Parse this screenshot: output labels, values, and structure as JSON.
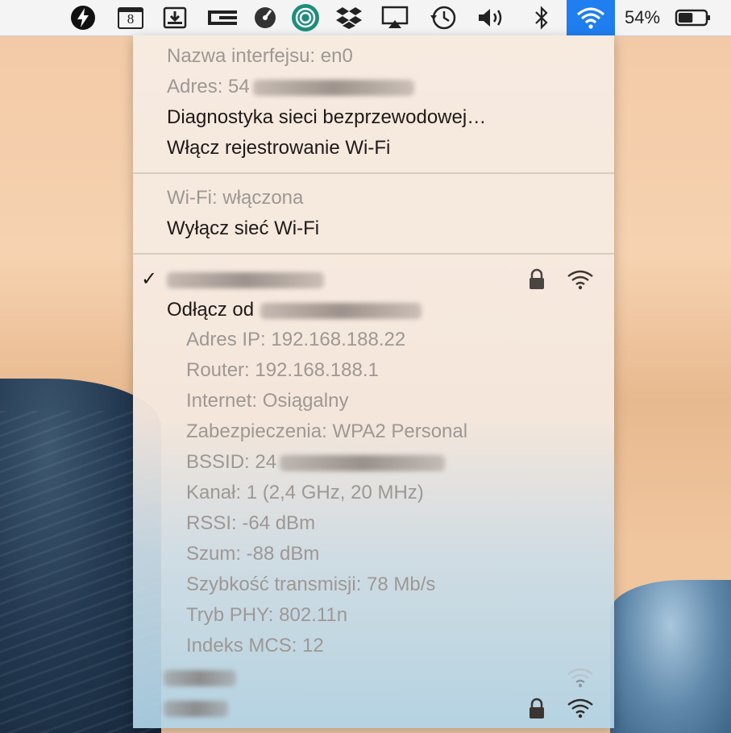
{
  "menubar": {
    "icons": [
      "bolt-icon",
      "calendar-icon",
      "download-icon",
      "window-icon",
      "gauge-icon",
      "circular-app-icon",
      "dropbox-icon",
      "airplay-icon",
      "time-machine-icon",
      "volume-icon",
      "bluetooth-icon",
      "wifi-icon"
    ],
    "calendar_day": "8",
    "battery_percent": "54%",
    "battery_level": 0.54,
    "wifi_active_color": "#1f7ef0"
  },
  "menu": {
    "interface_name": "Nazwa interfejsu: en0",
    "address_prefix": "Adres: 54",
    "wireless_diagnostics": "Diagnostyka sieci bezprzewodowej…",
    "enable_wifi_logging": "Włącz rejestrowanie Wi-Fi",
    "wifi_status": "Wi-Fi: włączona",
    "turn_wifi_off": "Wyłącz sieć Wi-Fi",
    "connected_network_check": "✓",
    "disconnect_prefix": "Odłącz od",
    "details": {
      "ip": "Adres IP: 192.168.188.22",
      "router": "Router: 192.168.188.1",
      "internet": "Internet: Osiągalny",
      "security": "Zabezpieczenia: WPA2 Personal",
      "bssid_prefix": "BSSID: 24",
      "channel": "Kanał: 1 (2,4 GHz, 20 MHz)",
      "rssi": "RSSI: -64 dBm",
      "noise": "Szum: -88 dBm",
      "tx_rate": "Szybkość transmisji: 78 Mb/s",
      "phy_mode": "Tryb PHY: 802.11n",
      "mcs_index": "Indeks MCS: 12"
    }
  }
}
